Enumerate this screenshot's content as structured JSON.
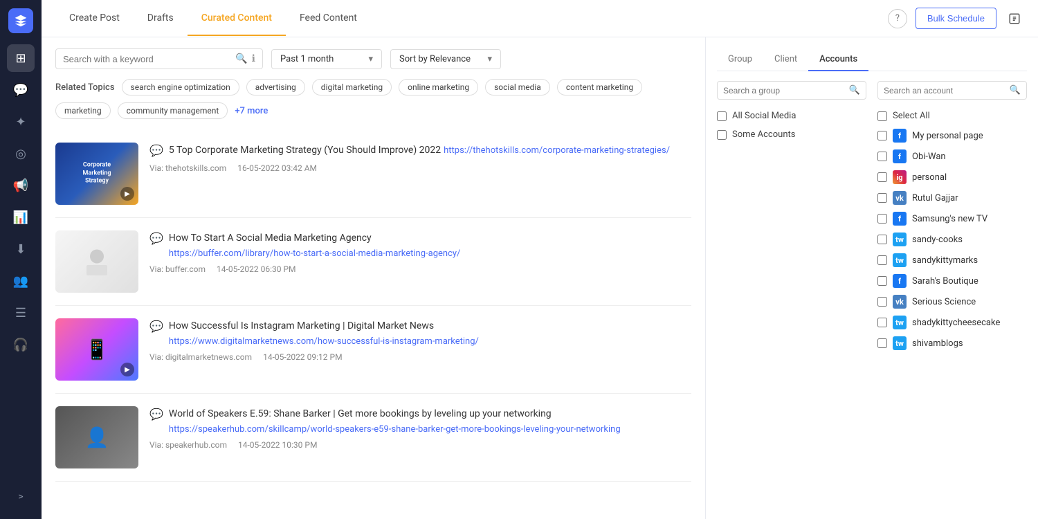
{
  "sidebar": {
    "logo_text": "→",
    "items": [
      {
        "id": "dashboard",
        "icon": "⊞",
        "active": false
      },
      {
        "id": "chat",
        "icon": "💬",
        "active": false
      },
      {
        "id": "star",
        "icon": "✦",
        "active": false
      },
      {
        "id": "radar",
        "icon": "◎",
        "active": false
      },
      {
        "id": "megaphone",
        "icon": "📢",
        "active": false
      },
      {
        "id": "chart",
        "icon": "📊",
        "active": false
      },
      {
        "id": "download",
        "icon": "⬇",
        "active": false
      },
      {
        "id": "users",
        "icon": "👥",
        "active": false
      },
      {
        "id": "list",
        "icon": "☰",
        "active": false
      },
      {
        "id": "support",
        "icon": "🎧",
        "active": false
      }
    ],
    "expand_icon": ">"
  },
  "nav": {
    "tabs": [
      {
        "id": "create-post",
        "label": "Create Post",
        "active": false
      },
      {
        "id": "drafts",
        "label": "Drafts",
        "active": false
      },
      {
        "id": "curated-content",
        "label": "Curated Content",
        "active": true
      },
      {
        "id": "feed-content",
        "label": "Feed Content",
        "active": false
      }
    ],
    "help_label": "?",
    "bulk_schedule_label": "Bulk Schedule",
    "export_icon": "⬜"
  },
  "search": {
    "placeholder": "Search with a keyword",
    "date_filter_value": "Past 1 month",
    "sort_filter_value": "Sort by Relevance"
  },
  "related_topics": {
    "label": "Related Topics",
    "topics": [
      "search engine optimization",
      "advertising",
      "digital marketing",
      "online marketing",
      "social media",
      "content marketing",
      "marketing",
      "community management"
    ],
    "more_label": "+7 more"
  },
  "articles": [
    {
      "id": "article-1",
      "title": "5 Top Corporate Marketing Strategy (You Should Improve) 2022",
      "url": "https://thehotskills.com/corporate-marketing-strategies/",
      "url_display": "https://thehotskills.com/corporate-marketing-strategies/",
      "via": "thehotskills.com",
      "date": "16-05-2022 03:42 AM",
      "thumb_class": "article-thumb-1",
      "thumb_text": "Corporate\nMarketing\nStrategy"
    },
    {
      "id": "article-2",
      "title": "How To Start A Social Media Marketing Agency",
      "url": "https://buffer.com/library/how-to-start-a-social-media-marketing-agency/",
      "url_display": "https://buffer.com/library/how-to-start-a-social-media-marketing-agency/",
      "via": "buffer.com",
      "date": "14-05-2022 06:30 PM",
      "thumb_class": "article-thumb-2",
      "thumb_text": ""
    },
    {
      "id": "article-3",
      "title": "How Successful Is Instagram Marketing | Digital Market News",
      "url": "https://www.digitalmarketnews.com/how-successful-is-instagram-marketing/",
      "url_display": "https://www.digitalmarketnews.com/how-successful-is-instagram-marketing/",
      "via": "digitalmarketnews.com",
      "date": "14-05-2022 09:12 PM",
      "thumb_class": "article-thumb-3",
      "thumb_text": ""
    },
    {
      "id": "article-4",
      "title": "World of Speakers E.59: Shane Barker | Get more bookings by leveling up your networking",
      "url": "https://speakerhub.com/skillcamp/world-speakers-e59-shane-barker-get-more-bookings-leveling-your-networking",
      "url_display": "https://speakerhub.com/skillcamp/world-speakers-e59-shane-barker-get-more-bookings-leveling-your-networking",
      "via": "speakerhub.com",
      "date": "14-05-2022 10:30 PM",
      "thumb_class": "article-thumb-4",
      "thumb_text": ""
    }
  ],
  "right_panel": {
    "tabs": [
      {
        "id": "group",
        "label": "Group",
        "active": false
      },
      {
        "id": "client",
        "label": "Client",
        "active": false
      },
      {
        "id": "accounts",
        "label": "Accounts",
        "active": true
      }
    ],
    "group_search_placeholder": "Search a group",
    "account_search_placeholder": "Search an account",
    "group_options": [
      {
        "label": "All Social Media",
        "checked": false
      },
      {
        "label": "Some Accounts",
        "checked": false
      }
    ],
    "account_select_all": "Select All",
    "accounts": [
      {
        "label": "My personal page",
        "avatar_type": "fb",
        "checked": false
      },
      {
        "label": "Obi-Wan",
        "avatar_type": "fb",
        "checked": false
      },
      {
        "label": "personal",
        "avatar_type": "ig",
        "checked": false
      },
      {
        "label": "Rutul Gajjar",
        "avatar_type": "vk",
        "checked": false
      },
      {
        "label": "Samsung's new TV",
        "avatar_type": "fb",
        "checked": false
      },
      {
        "label": "sandy-cooks",
        "avatar_type": "tw",
        "checked": false
      },
      {
        "label": "sandykittymarks",
        "avatar_type": "tw",
        "checked": false
      },
      {
        "label": "Sarah's Boutique",
        "avatar_type": "fb",
        "checked": false
      },
      {
        "label": "Serious Science",
        "avatar_type": "vk",
        "checked": false
      },
      {
        "label": "shadykittycheesecake",
        "avatar_type": "tw",
        "checked": false
      },
      {
        "label": "shivamblogs",
        "avatar_type": "tw",
        "checked": false
      }
    ]
  }
}
